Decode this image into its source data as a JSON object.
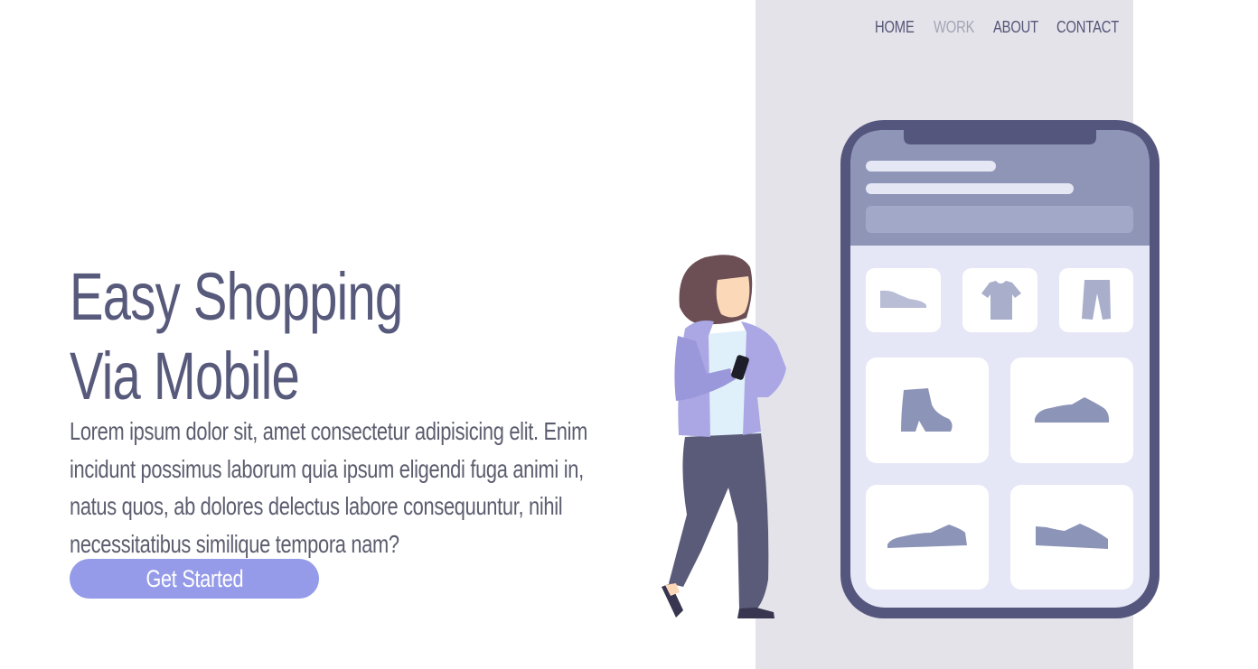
{
  "nav": {
    "items": [
      {
        "label": "HOME",
        "active": false
      },
      {
        "label": "WORK",
        "active": true
      },
      {
        "label": "ABOUT",
        "active": false
      },
      {
        "label": "CONTACT",
        "active": false
      }
    ]
  },
  "hero": {
    "title_line1": "Easy Shopping",
    "title_line2": "Via Mobile",
    "description": "Lorem ipsum dolor sit, amet consectetur adipisicing elit. Enim incidunt possimus laborum quia ipsum eligendi fuga animi in, natus quos, ab dolores delectus labore consequuntur, nihil necessitatibus similique tempora nam?",
    "cta_label": "Get Started"
  },
  "illustration": {
    "phone_products": [
      "shoe-icon",
      "tshirt-icon",
      "pants-icon",
      "boot-icon",
      "sneaker-icon",
      "sneaker-icon",
      "sneaker-icon"
    ],
    "person": "woman-with-phone"
  },
  "colors": {
    "accent": "#959be9",
    "heading": "#585a7c",
    "panel": "#e4e3ea",
    "phone_frame": "#55567d",
    "phone_header": "#8e95b6",
    "product_icon": "#8c94b8"
  }
}
